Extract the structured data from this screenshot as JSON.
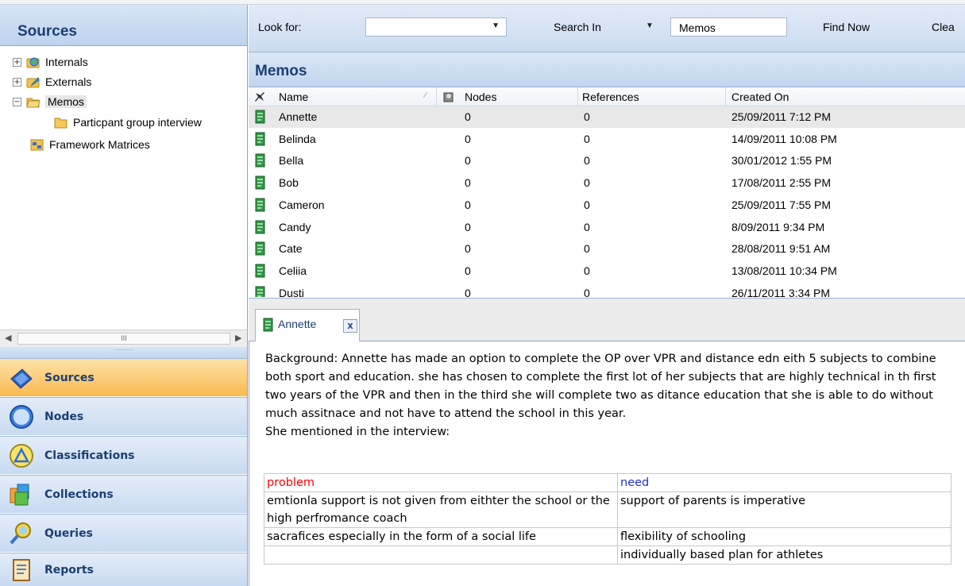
{
  "left_pane": {
    "title": "Sources",
    "tree": [
      {
        "label": "Internals",
        "expander": "+"
      },
      {
        "label": "Externals",
        "expander": "+"
      },
      {
        "label": "Memos",
        "expander": "−"
      },
      {
        "label": "Particpant group interview"
      },
      {
        "label": "Framework Matrices"
      }
    ],
    "scroll_thumb": "III",
    "nav": [
      {
        "label": "Sources",
        "icon": "sources-icon"
      },
      {
        "label": "Nodes",
        "icon": "nodes-icon"
      },
      {
        "label": "Classifications",
        "icon": "classifications-icon"
      },
      {
        "label": "Collections",
        "icon": "collections-icon"
      },
      {
        "label": "Queries",
        "icon": "queries-icon"
      },
      {
        "label": "Reports",
        "icon": "reports-icon"
      }
    ]
  },
  "search": {
    "look_for_label": "Look for:",
    "look_for_value": "",
    "search_in_label": "Search In",
    "search_in_value": "Memos",
    "find_now": "Find Now",
    "clear": "Clea"
  },
  "memos": {
    "title": "Memos",
    "columns": {
      "name": "Name",
      "nodes": "Nodes",
      "references": "References",
      "created_on": "Created On"
    },
    "rows": [
      {
        "name": "Annette",
        "nodes": "0",
        "references": "0",
        "created_on": "25/09/2011 7:12 PM"
      },
      {
        "name": "Belinda",
        "nodes": "0",
        "references": "0",
        "created_on": "14/09/2011 10:08 PM"
      },
      {
        "name": "Bella",
        "nodes": "0",
        "references": "0",
        "created_on": "30/01/2012 1:55 PM"
      },
      {
        "name": "Bob",
        "nodes": "0",
        "references": "0",
        "created_on": "17/08/2011 2:55 PM"
      },
      {
        "name": "Cameron",
        "nodes": "0",
        "references": "0",
        "created_on": "25/09/2011 7:55 PM"
      },
      {
        "name": "Candy",
        "nodes": "0",
        "references": "0",
        "created_on": "8/09/2011 9:34 PM"
      },
      {
        "name": "Cate",
        "nodes": "0",
        "references": "0",
        "created_on": "28/08/2011 9:51 AM"
      },
      {
        "name": "Celiia",
        "nodes": "0",
        "references": "0",
        "created_on": "13/08/2011 10:34 PM"
      },
      {
        "name": "Dusti",
        "nodes": "0",
        "references": "0",
        "created_on": "26/11/2011 3:34 PM"
      }
    ]
  },
  "document": {
    "tab_label": "Annette",
    "close_label": "x",
    "paragraph": "Background: Annette has made an option to complete the OP over VPR and distance edn eith 5 subjects to combine both sport and education. she has chosen to complete the first lot of her subjects that are highly technical in th first two years of the VPR and then in the third she will complete two as ditance education that she is able to do without much assitnace and not have to attend the school in this year.",
    "intro_line": "She mentioned in the interview:",
    "table": {
      "col1_header": "problem",
      "col2_header": "need",
      "rows": [
        [
          "emtionla support is not given from eithter the school or the high perfromance coach",
          "support of parents is imperative"
        ],
        [
          "sacrafices  especially in the form of a social life",
          "flexibility of schooling"
        ],
        [
          "",
          "individually based plan for athletes"
        ]
      ]
    }
  },
  "colors": {
    "header_text": "#1b3f73",
    "problem_red": "#ff0000",
    "need_blue": "#1f2fd6",
    "active_nav": "#f9b94f"
  }
}
